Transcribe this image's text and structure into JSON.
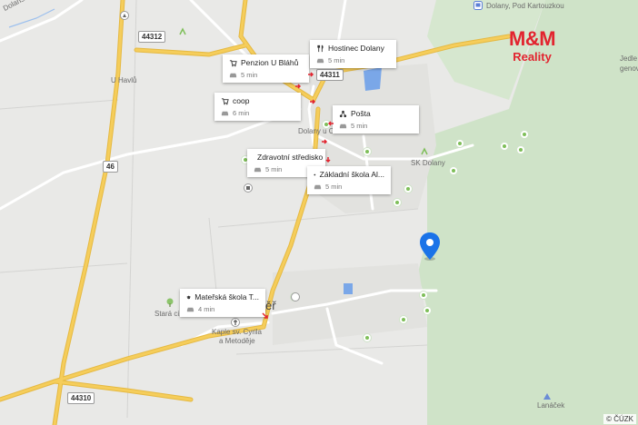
{
  "map": {
    "pois": [
      {
        "icon": "cart-icon",
        "name": "Penzion U Bláhů",
        "time": "5 min"
      },
      {
        "icon": "fork-knife-icon",
        "name": "Hostinec Dolany",
        "time": "5 min"
      },
      {
        "icon": "cart-icon",
        "name": "coop",
        "time": "6 min"
      },
      {
        "icon": "post-icon",
        "name": "Pošta",
        "time": "5 min"
      },
      {
        "icon": "medical-cross-icon",
        "name": "Zdravotní středisko",
        "time": "5 min"
      },
      {
        "icon": "graduation-cap-icon",
        "name": "Základní škola Al...",
        "time": "5 min"
      },
      {
        "icon": "graduation-cap-icon",
        "name": "Mateřská škola T...",
        "time": "4 min"
      }
    ],
    "road_badges": [
      "44312",
      "44311",
      "46",
      "44310"
    ],
    "place_labels": {
      "havli": "U Havlů",
      "potok": "Dolanský potok",
      "dolany_ol": "Dolany u Ol...",
      "sk_dolany": "SK Dolany",
      "bus_stop": "Dolany, Pod Kartouzkou",
      "jedle": "Jedle",
      "genov": "genov",
      "stara": "Stará ci...",
      "kaple": "Kaple sv. Cyrila",
      "metodeje": "a Metoděje",
      "townlabel": "ěř",
      "lanacek": "Lanáček"
    },
    "colors": {
      "background": "#e9e9e7",
      "forest": "#cfe3c8",
      "main_road": "#f5cd5b",
      "water": "#7aa7e8",
      "pin": "#1a73e8",
      "brand": "#e2242f"
    }
  },
  "logo": {
    "brand": "M&M",
    "sub": "Reality"
  },
  "copyright": "© ČÚZK"
}
